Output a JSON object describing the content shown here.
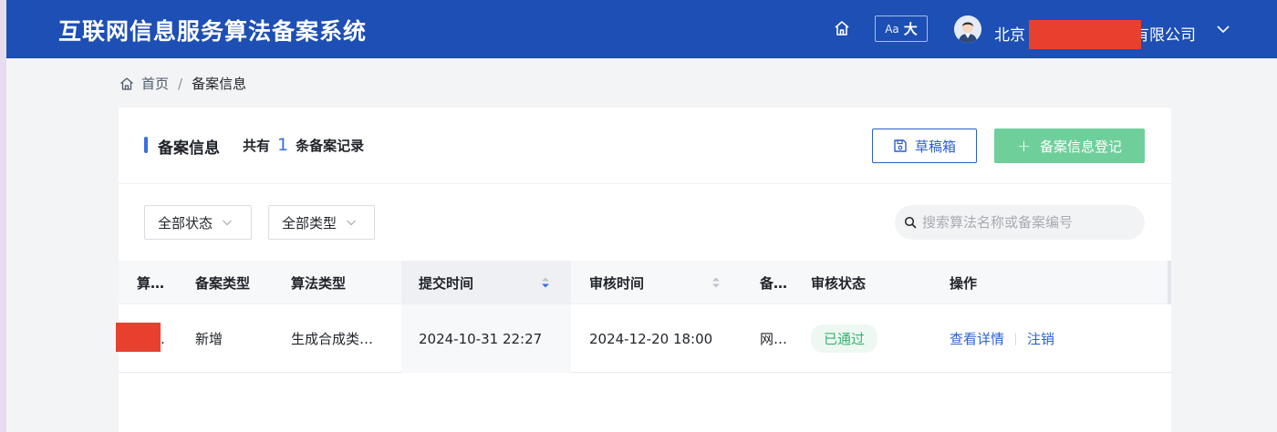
{
  "header": {
    "app_title": "互联网信息服务算法备案系统",
    "font_size_btn": {
      "small": "Aa",
      "large": "大"
    },
    "company_prefix": "北京",
    "company_suffix": "有限公司"
  },
  "breadcrumb": {
    "home": "首页",
    "separator": "/",
    "current": "备案信息"
  },
  "card": {
    "title": "备案信息",
    "count_prefix": "共有",
    "count_value": "1",
    "count_suffix": "条备案记录",
    "draft_button": "草稿箱",
    "register_button": "备案信息登记"
  },
  "filters": {
    "status": "全部状态",
    "type": "全部类型",
    "search_placeholder": "搜索算法名称或备案编号"
  },
  "table": {
    "columns": [
      "算…",
      "备案类型",
      "算法类型",
      "提交时间",
      "审核时间",
      "备…",
      "审核状态",
      "操作"
    ],
    "rows": [
      {
        "col1": ".",
        "filing_type": "新增",
        "algo_type": "生成合成类…",
        "submit_time": "2024-10-31 22:27",
        "review_time": "2024-12-20 18:00",
        "col6": "网…",
        "status": "已通过",
        "action_view": "查看详情",
        "action_cancel": "注销"
      }
    ]
  },
  "colors": {
    "header_bg": "#1d4fb4",
    "accent": "#3a6fe0",
    "success": "#33b46e",
    "register_btn": "#6fcf9b",
    "redaction": "#e8402e"
  }
}
